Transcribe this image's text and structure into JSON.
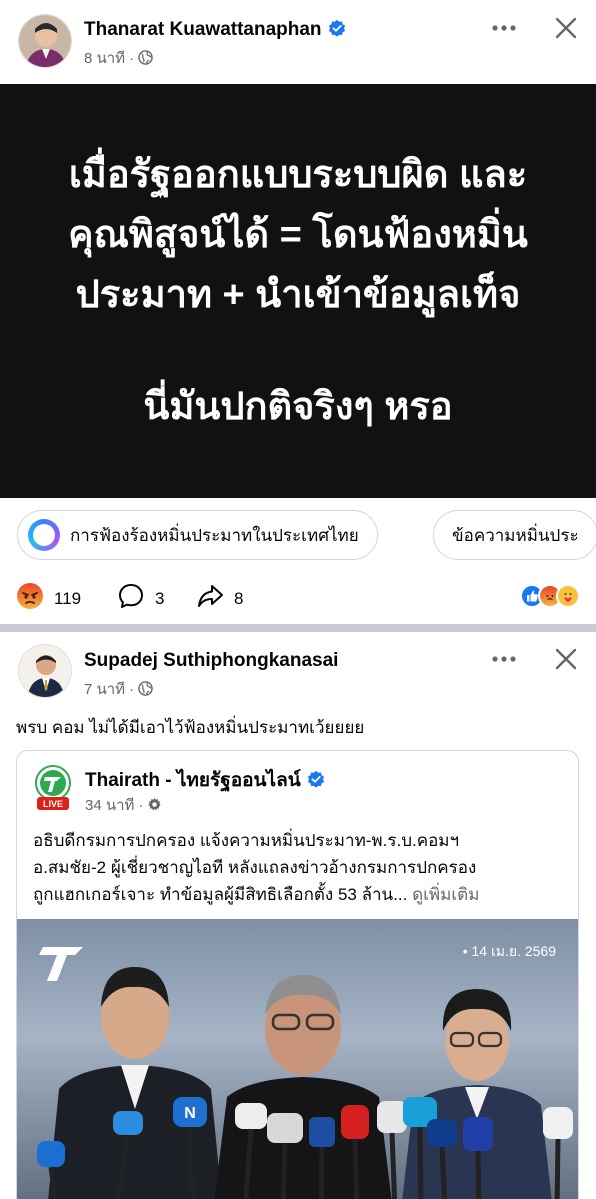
{
  "post1": {
    "author": "Thanarat Kuawattanaphan",
    "time": "8 นาที",
    "text_lines": [
      "เมื่อรัฐออกแบบระบบผิด และ",
      "คุณพิสูจน์ได้ = โดนฟ้องหมิ่น",
      "ประมาท + นำเข้าข้อมูลเท็จ",
      "นี่มันปกติจริงๆ หรอ"
    ],
    "chips": [
      "การฟ้องร้องหมิ่นประมาทในประเทศไทย",
      "ข้อความหมิ่นประ"
    ],
    "reactions_count": "119",
    "comments_count": "3",
    "shares_count": "8"
  },
  "post2": {
    "author": "Supadej Suthiphongkanasai",
    "time": "7 นาที",
    "text": "พรบ คอม ไม่ได้มีเอาไว้ฟ้องหมิ่นประมาทเว้ยยยย",
    "shared": {
      "author": "Thairath - ไทยรัฐออนไลน์",
      "time": "34 นาที",
      "live_badge": "LIVE",
      "body_lines": [
        "อธิบดีกรมการปกครอง แจ้งความหมิ่นประมาท-พ.ร.บ.คอมฯ",
        "อ.สมชัย-2 ผู้เชี่ยวชาญไอที หลังแถลงข่าวอ้างกรมการปกครอง",
        "ถูกแฮกเกอร์เจาะ ทำข้อมูลผู้มีสิทธิเลือกตั้ง 53 ล้าน..."
      ],
      "see_more": "ดูเพิ่มเติม",
      "photo_date": "• 14 เม.ย. 2569"
    }
  },
  "colors": {
    "text_card_bg": "#111111",
    "secondary_text": "#65676b",
    "verified_blue": "#1877f2",
    "divider": "#c9ccd1"
  }
}
